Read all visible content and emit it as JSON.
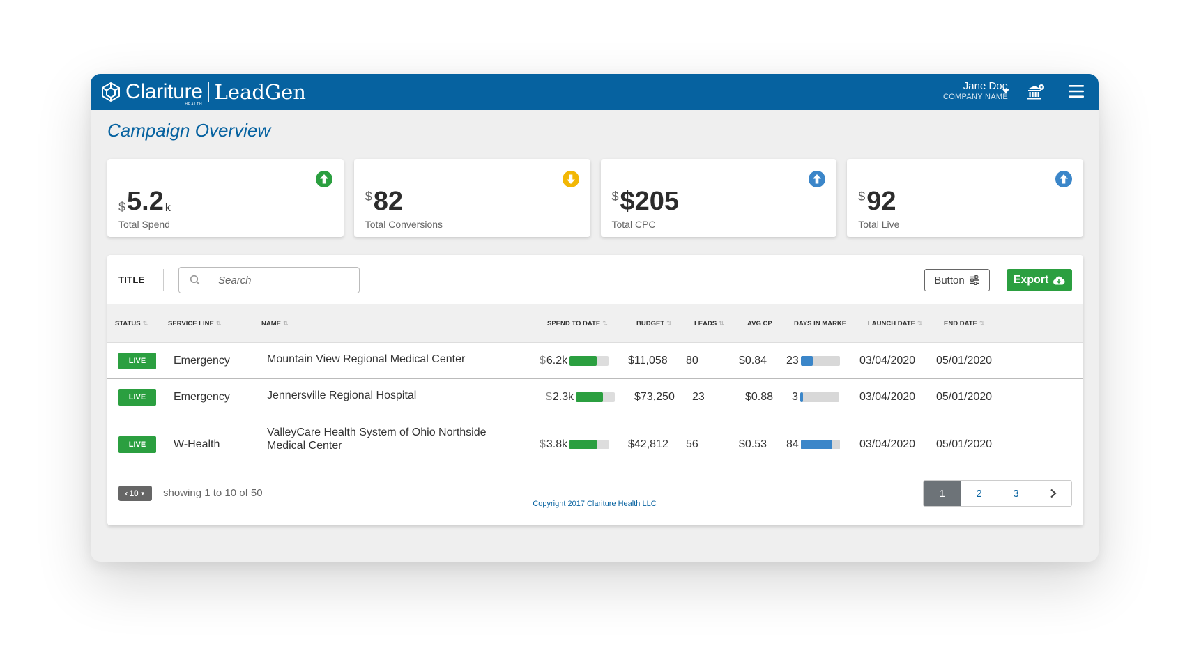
{
  "brand": {
    "name": "Clariture",
    "sub": "HEALTH",
    "product": "LeadGen"
  },
  "user": {
    "name": "Jane Doe",
    "company": "COMPANY NAME"
  },
  "page_title": "Campaign Overview",
  "cards": [
    {
      "currency": "$",
      "value": "5.2",
      "suffix": "k",
      "label": "Total Spend",
      "trend": "up",
      "color": "#2b9f40"
    },
    {
      "currency": "$",
      "value": "82",
      "suffix": "",
      "label": "Total Conversions",
      "trend": "down",
      "color": "#f2b705"
    },
    {
      "currency": "$",
      "value": "$205",
      "suffix": "",
      "label": "Total CPC",
      "trend": "up",
      "color": "#3b86c9"
    },
    {
      "currency": "$",
      "value": "92",
      "suffix": "",
      "label": "Total Live",
      "trend": "up",
      "color": "#3b86c9"
    }
  ],
  "toolbar": {
    "title": "TITLE",
    "search_placeholder": "Search",
    "button_label": "Button",
    "export_label": "Export"
  },
  "table": {
    "headers": [
      "STATUS",
      "SERVICE LINE",
      "NAME",
      "SPEND TO DATE",
      "BUDGET",
      "LEADS",
      "AVG CPI",
      "DAYS IN MARKET",
      "LAUNCH DATE",
      "END DATE"
    ],
    "rows": [
      {
        "status": "LIVE",
        "service_line": "Emergency",
        "name": "Mountain View Regional Medical Center",
        "spend_currency": "$",
        "spend": "6.2k",
        "spend_fraction": 0.7,
        "budget": "$11,058",
        "leads": "80",
        "avg_cpi": "$0.84",
        "days": "23",
        "days_fraction": 0.3,
        "launch": "03/04/2020",
        "end": "05/01/2020"
      },
      {
        "status": "LIVE",
        "service_line": "Emergency",
        "name": "Jennersville Regional Hospital",
        "spend_currency": "$",
        "spend": "2.3k",
        "spend_fraction": 0.7,
        "budget": "$73,250",
        "leads": "23",
        "avg_cpi": "$0.88",
        "days": "3",
        "days_fraction": 0.08,
        "launch": "03/04/2020",
        "end": "05/01/2020"
      },
      {
        "status": "LIVE",
        "service_line": "W-Health",
        "name": "ValleyCare Health System of Ohio Northside Medical Center",
        "spend_currency": "$",
        "spend": "3.8k",
        "spend_fraction": 0.7,
        "budget": "$42,812",
        "leads": "56",
        "avg_cpi": "$0.53",
        "days": "84",
        "days_fraction": 0.8,
        "launch": "03/04/2020",
        "end": "05/01/2020"
      }
    ]
  },
  "pagination": {
    "per_page": "10",
    "showing": "showing 1 to 10 of 50",
    "pages": [
      "1",
      "2",
      "3"
    ],
    "active_page": "1"
  },
  "colors": {
    "primary": "#0662a0",
    "success": "#2b9f40",
    "bar_green": "#2b9f40",
    "bar_blue": "#3b86c9"
  },
  "copyright": "Copyright 2017 Clariture Health LLC"
}
